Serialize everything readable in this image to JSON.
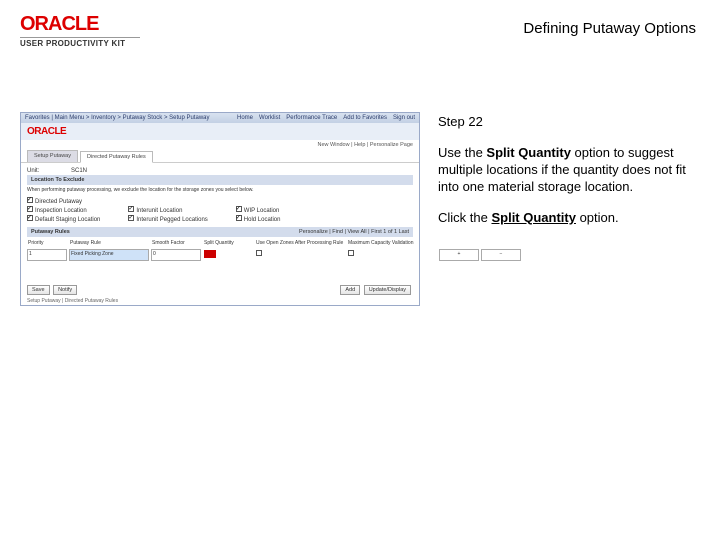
{
  "header": {
    "brand": "ORACLE",
    "sub_brand": "USER PRODUCTIVITY KIT",
    "page_title": "Defining Putaway Options"
  },
  "mock": {
    "topbar_left": "Favorites | Main Menu > Inventory > Putaway Stock > Setup Putaway",
    "topbar_right": [
      "Home",
      "Worklist",
      "Performance Trace",
      "Add to Favorites",
      "Sign out"
    ],
    "brand": "ORACLE",
    "meta_right": "New Window | Help | Personalize Page",
    "tabs": [
      "Setup Putaway",
      "Directed Putaway Rules"
    ],
    "unit_label": "Unit:",
    "unit_value": "SC1N",
    "panel_title": "Location To Exclude",
    "panel_desc": "When performing putaway processing, we exclude the location for the storage zones you select below.",
    "exclusions_col1": [
      "Directed Putaway",
      "Inspection Location",
      "Default Staging Location"
    ],
    "excl_col2": [
      "Interunit Location",
      "Interunit Pegged Locations"
    ],
    "excl_col3": [
      "WIP Location",
      "Hold Location"
    ],
    "section_title": "Putaway Rules",
    "grid_nav": "Personalize | Find | View All | First 1 of 1 Last",
    "grid_heads": [
      "Priority",
      "Putaway Rule",
      "Smooth Factor",
      "Split Quantity",
      "Use Open Zones After Processing Rule",
      "Maximum Capacity Validation",
      "",
      ""
    ],
    "grid_row": [
      "1",
      "Fixed Picking Zone",
      "0"
    ],
    "footer_left": [
      "Save",
      "Notify"
    ],
    "footer_right": [
      "Add",
      "Update/Display"
    ],
    "footer_meta": "Setup Putaway | Directed Putaway Rules"
  },
  "instr": {
    "step_label": "Step 22",
    "p1_a": "Use the ",
    "p1_b": "Split Quantity",
    "p1_c": " option to suggest multiple locations if the quantity does not fit into one material storage location.",
    "p2_a": "Click the ",
    "p2_b": "Split Quantity",
    "p2_c": " option."
  }
}
